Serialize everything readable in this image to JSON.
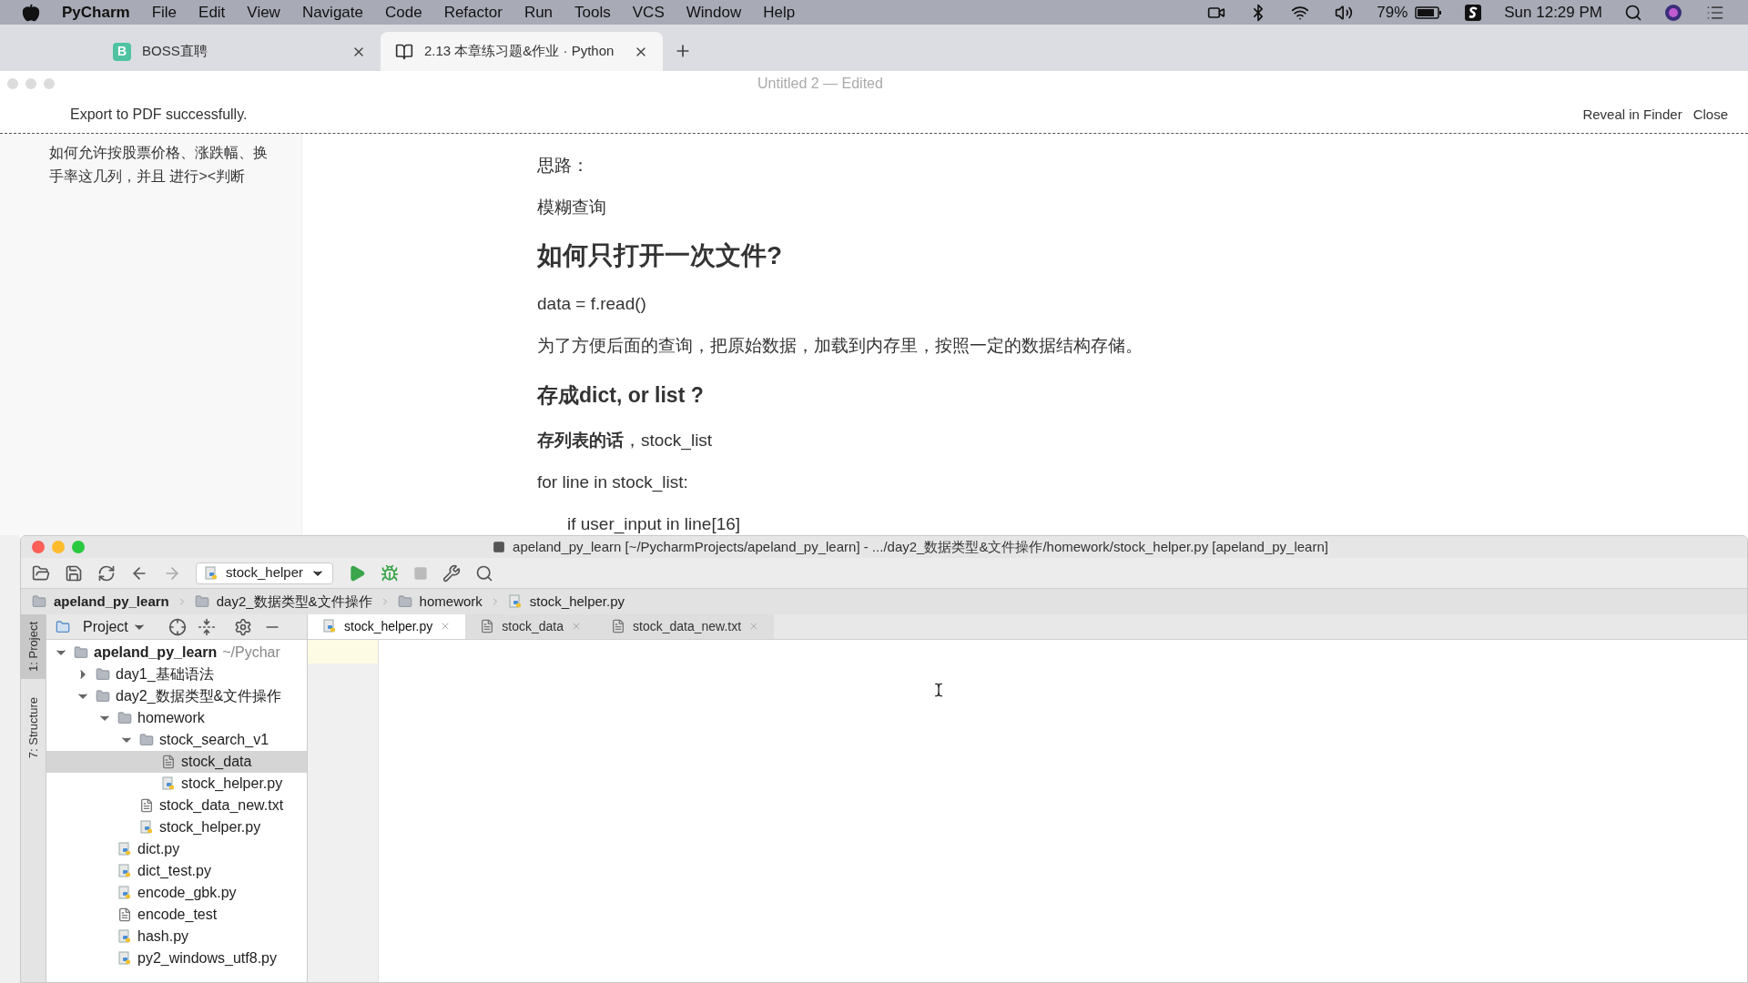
{
  "menu_bar": {
    "app": "PyCharm",
    "items": [
      "File",
      "Edit",
      "View",
      "Navigate",
      "Code",
      "Refactor",
      "Run",
      "Tools",
      "VCS",
      "Window",
      "Help"
    ],
    "battery": "79%",
    "clock": "Sun 12:29 PM"
  },
  "browser_tabs": [
    {
      "icon": "B",
      "label": "BOSS直聘",
      "selected": false
    },
    {
      "label": "2.13 本章练习题&作业 · Python",
      "selected": true
    }
  ],
  "typora": {
    "title": "Untitled 2 — Edited",
    "notice": "Export to PDF successfully.",
    "notice_actions": [
      "Reveal in Finder",
      "Close"
    ],
    "outline": "如何允许按股票价格、涨跌幅、换手率这几列，并且 进行><判断",
    "blocks": [
      {
        "kind": "p",
        "text": "思路："
      },
      {
        "kind": "p",
        "text": "模糊查询"
      },
      {
        "kind": "h2",
        "text": "如何只打开一次文件?"
      },
      {
        "kind": "p",
        "text": "data = f.read()"
      },
      {
        "kind": "p",
        "text": "为了方便后面的查询，把原始数据，加载到内存里，按照一定的数据结构存储。"
      },
      {
        "kind": "h3",
        "text": "存成dict, or list ?"
      },
      {
        "kind": "p",
        "text": "**存列表的话**，stock_list"
      },
      {
        "kind": "p",
        "text": "for line in stock_list:"
      },
      {
        "kind": "indent",
        "text": "if user_input in line[16]"
      }
    ]
  },
  "pycharm": {
    "title": "apeland_py_learn [~/PycharmProjects/apeland_py_learn] - .../day2_数据类型&文件操作/homework/stock_helper.py [apeland_py_learn]",
    "run_config": "stock_helper",
    "breadcrumbs": [
      {
        "text": "apeland_py_learn",
        "kind": "folder"
      },
      {
        "text": "day2_数据类型&文件操作",
        "kind": "folder"
      },
      {
        "text": "homework",
        "kind": "folder"
      },
      {
        "text": "stock_helper.py",
        "kind": "py"
      }
    ],
    "side_tabs": [
      {
        "label": "1: Project",
        "selected": true
      },
      {
        "label": "7: Structure",
        "selected": false
      }
    ],
    "project_panel": {
      "title": "Project"
    },
    "tree": [
      {
        "name": "apeland_py_learn",
        "hint": "~/Pychar",
        "kind": "folder",
        "expanded": true,
        "selected": false,
        "children": [
          {
            "name": "day1_基础语法",
            "kind": "folder",
            "expanded": false,
            "selected": false
          },
          {
            "name": "day2_数据类型&文件操作",
            "kind": "folder",
            "expanded": true,
            "selected": false,
            "children": [
              {
                "name": "homework",
                "kind": "folder",
                "expanded": true,
                "selected": false,
                "children": [
                  {
                    "name": "stock_search_v1",
                    "kind": "folder",
                    "expanded": true,
                    "selected": false,
                    "children": [
                      {
                        "name": "stock_data",
                        "kind": "text",
                        "selected": true
                      },
                      {
                        "name": "stock_helper.py",
                        "kind": "py",
                        "selected": false
                      }
                    ]
                  },
                  {
                    "name": "stock_data_new.txt",
                    "kind": "text",
                    "selected": false
                  },
                  {
                    "name": "stock_helper.py",
                    "kind": "py",
                    "selected": false
                  }
                ]
              },
              {
                "name": "dict.py",
                "kind": "py",
                "selected": false
              },
              {
                "name": "dict_test.py",
                "kind": "py",
                "selected": false
              },
              {
                "name": "encode_gbk.py",
                "kind": "py",
                "selected": false
              },
              {
                "name": "encode_test",
                "kind": "text",
                "selected": false
              },
              {
                "name": "hash.py",
                "kind": "py",
                "selected": false
              },
              {
                "name": "py2_windows_utf8.py",
                "kind": "py",
                "selected": false
              }
            ]
          }
        ]
      }
    ],
    "editor_tabs": [
      {
        "label": "stock_helper.py",
        "kind": "py",
        "selected": true
      },
      {
        "label": "stock_data",
        "kind": "text",
        "selected": false
      },
      {
        "label": "stock_data_new.txt",
        "kind": "text",
        "selected": false
      }
    ]
  }
}
